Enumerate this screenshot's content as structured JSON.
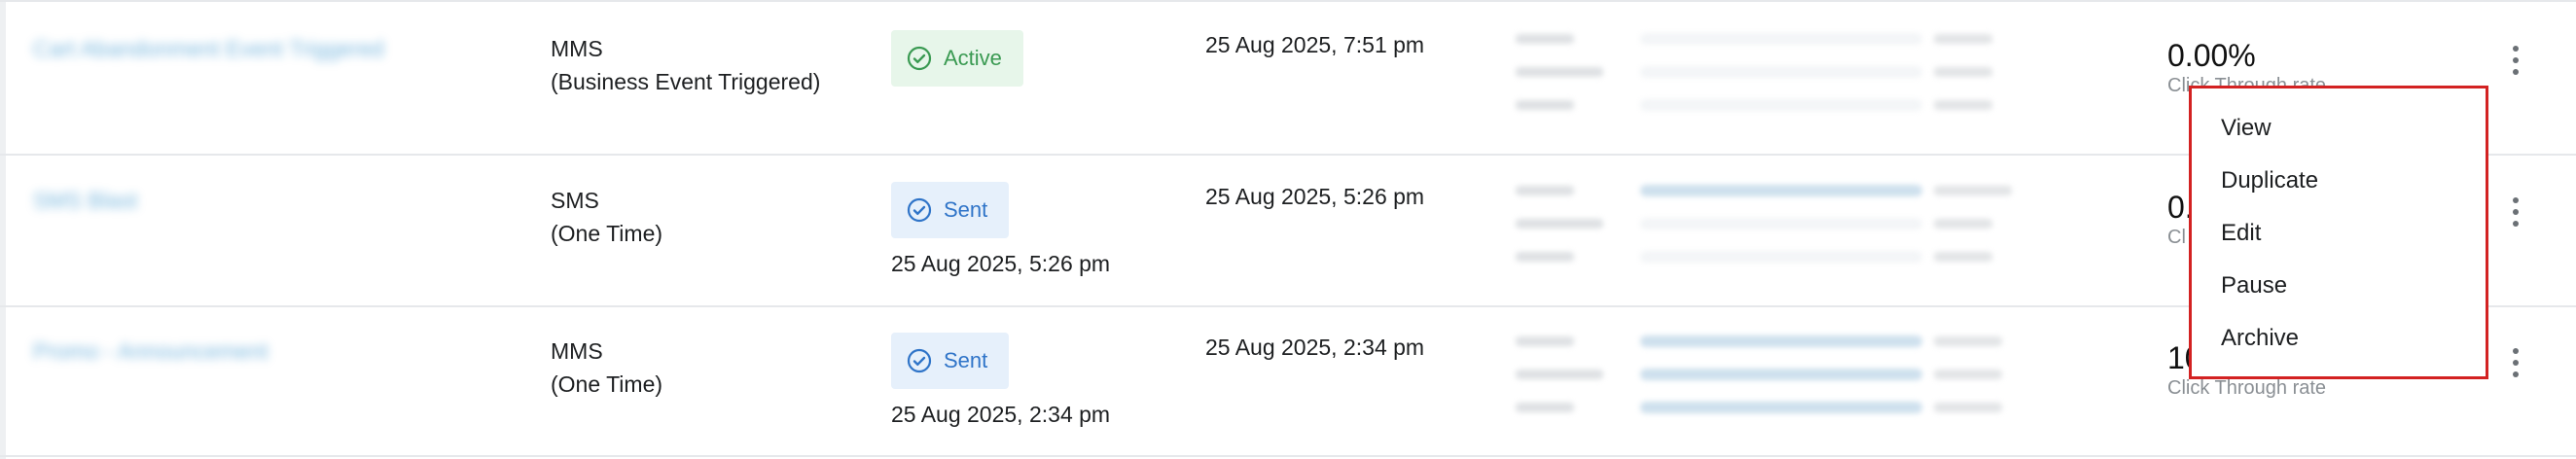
{
  "rows": [
    {
      "name": "Cart Abandonment Event Triggered",
      "channel_type": "MMS",
      "channel_trigger": "(Business Event Triggered)",
      "status": "Active",
      "status_date": "",
      "created": "25 Aug 2025, 7:51 pm",
      "rate": "0.00%",
      "rate_label": "Click Through rate"
    },
    {
      "name": "SMS Blast",
      "channel_type": "SMS",
      "channel_trigger": "(One Time)",
      "status": "Sent",
      "status_date": "25 Aug 2025, 5:26 pm",
      "created": "25 Aug 2025, 5:26 pm",
      "rate": "0.",
      "rate_label": "Cl"
    },
    {
      "name": "Promo - Announcement",
      "channel_type": "MMS",
      "channel_trigger": "(One Time)",
      "status": "Sent",
      "status_date": "25 Aug 2025, 2:34 pm",
      "created": "25 Aug 2025, 2:34 pm",
      "rate": "10",
      "rate_label": "Click Through rate"
    }
  ],
  "context_menu": {
    "items": [
      "View",
      "Duplicate",
      "Edit",
      "Pause",
      "Archive"
    ]
  },
  "colors": {
    "active_bg": "#e7f6ea",
    "active_fg": "#3a9a52",
    "sent_bg": "#e6f0fb",
    "sent_fg": "#2f74c8",
    "menu_border": "#d32222"
  },
  "icons": {
    "status": "check-circle-icon",
    "row_menu": "kebab-menu-icon"
  }
}
